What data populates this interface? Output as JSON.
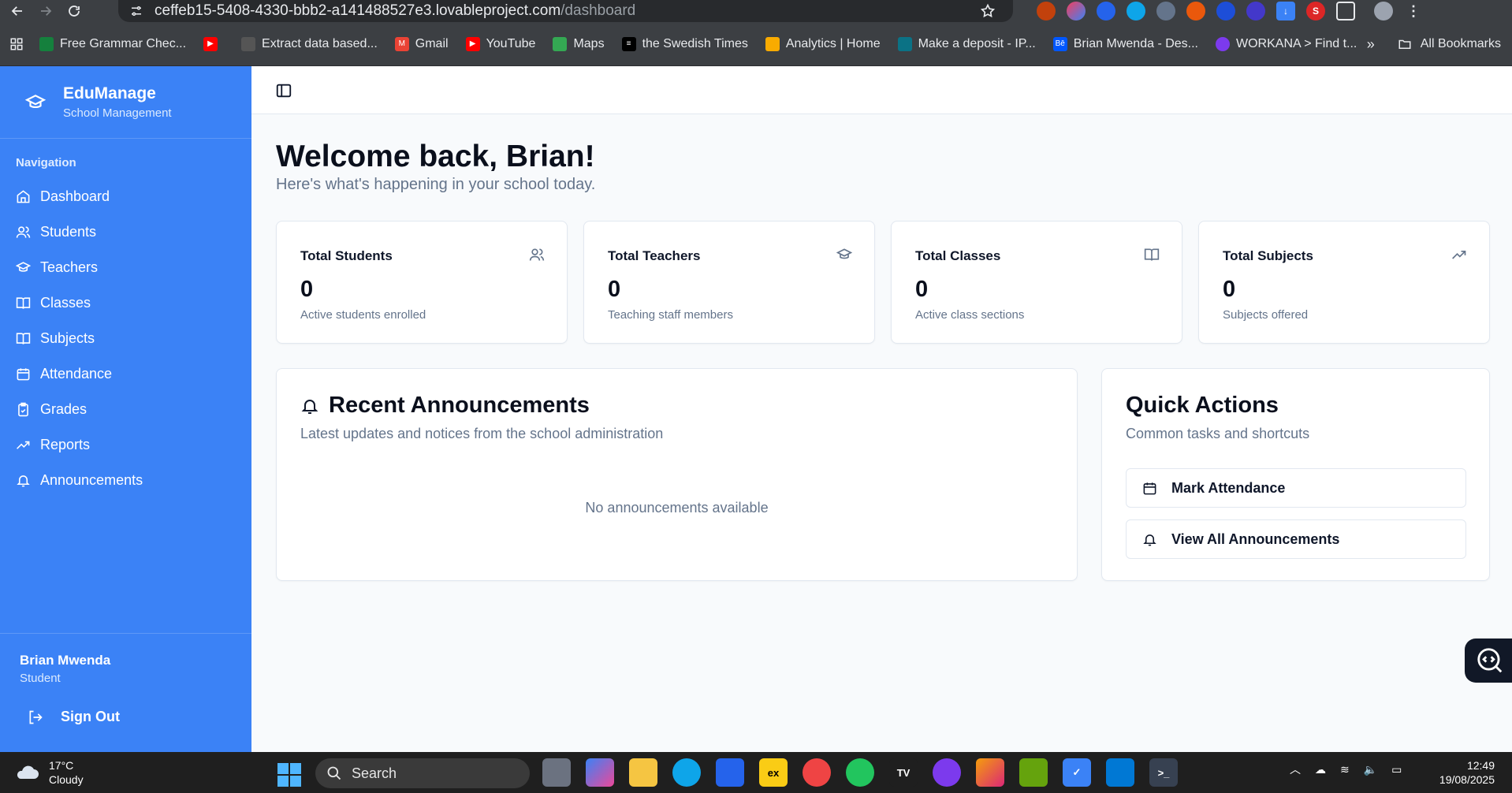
{
  "browser": {
    "url_host": "ceffeb15-5408-4330-bbb2-a141488527e3.lovableproject.com",
    "url_path": "/dashboard",
    "bookmarks": [
      {
        "label": "Free Grammar Chec...",
        "color": "#15803d"
      },
      {
        "label": "",
        "color": "#ff0000"
      },
      {
        "label": "Extract data based...",
        "color": "#555555"
      },
      {
        "label": "Gmail",
        "color": "#ea4335"
      },
      {
        "label": "YouTube",
        "color": "#ff0000"
      },
      {
        "label": "Maps",
        "color": "#34a853"
      },
      {
        "label": "the Swedish Times",
        "color": "#000000"
      },
      {
        "label": "Analytics | Home",
        "color": "#f9ab00"
      },
      {
        "label": "Make a deposit - IP...",
        "color": "#0b7285"
      },
      {
        "label": "Brian Mwenda - Des...",
        "color": "#0057ff"
      },
      {
        "label": "WORKANA > Find t...",
        "color": "#7c3aed"
      }
    ],
    "all_bookmarks": "All Bookmarks"
  },
  "sidebar": {
    "brand_title": "EduManage",
    "brand_sub": "School Management",
    "nav_heading": "Navigation",
    "items": [
      {
        "label": "Dashboard",
        "icon": "home-icon"
      },
      {
        "label": "Students",
        "icon": "users-icon"
      },
      {
        "label": "Teachers",
        "icon": "graduation-cap-icon"
      },
      {
        "label": "Classes",
        "icon": "book-open-icon"
      },
      {
        "label": "Subjects",
        "icon": "book-open-icon"
      },
      {
        "label": "Attendance",
        "icon": "calendar-icon"
      },
      {
        "label": "Grades",
        "icon": "clipboard-check-icon"
      },
      {
        "label": "Reports",
        "icon": "trending-up-icon"
      },
      {
        "label": "Announcements",
        "icon": "bell-icon"
      }
    ],
    "user_name": "Brian Mwenda",
    "user_role": "Student",
    "sign_out": "Sign Out"
  },
  "main": {
    "welcome": "Welcome back, Brian!",
    "welcome_sub": "Here's what's happening in your school today.",
    "stats": [
      {
        "title": "Total Students",
        "value": "0",
        "desc": "Active students enrolled",
        "icon": "users-icon"
      },
      {
        "title": "Total Teachers",
        "value": "0",
        "desc": "Teaching staff members",
        "icon": "graduation-cap-icon"
      },
      {
        "title": "Total Classes",
        "value": "0",
        "desc": "Active class sections",
        "icon": "book-open-icon"
      },
      {
        "title": "Total Subjects",
        "value": "0",
        "desc": "Subjects offered",
        "icon": "trending-up-icon"
      }
    ],
    "announcements": {
      "title": "Recent Announcements",
      "sub": "Latest updates and notices from the school administration",
      "empty": "No announcements available"
    },
    "quick_actions": {
      "title": "Quick Actions",
      "sub": "Common tasks and shortcuts",
      "buttons": [
        "Mark Attendance",
        "View All Announcements"
      ]
    }
  },
  "taskbar": {
    "temp": "17°C",
    "condition": "Cloudy",
    "search": "Search",
    "time": "12:49",
    "date": "19/08/2025"
  },
  "colors": {
    "sidebar": "#3b82f6",
    "background": "#f8fafc"
  }
}
